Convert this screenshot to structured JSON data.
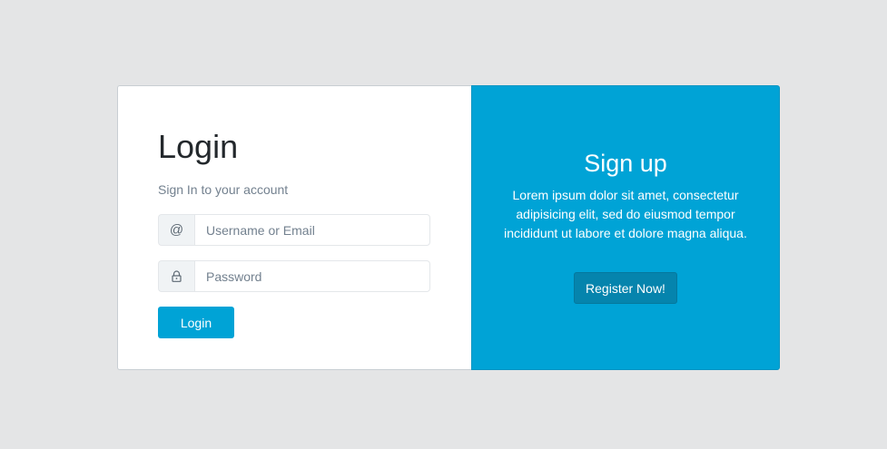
{
  "login": {
    "title": "Login",
    "subtitle": "Sign In to your account",
    "username": {
      "icon": "at-icon",
      "icon_glyph": "@",
      "placeholder": "Username or Email",
      "value": ""
    },
    "password": {
      "icon": "lock-icon",
      "placeholder": "Password",
      "value": ""
    },
    "button_label": "Login"
  },
  "signup": {
    "title": "Sign up",
    "text": "Lorem ipsum dolor sit amet, consectetur adipisicing elit, sed do eiusmod tempor incididunt ut labore et dolore magna aliqua.",
    "button_label": "Register Now!"
  },
  "colors": {
    "accent": "#00a3d6",
    "accent_dark": "#0584ad",
    "background": "#e4e5e6"
  }
}
